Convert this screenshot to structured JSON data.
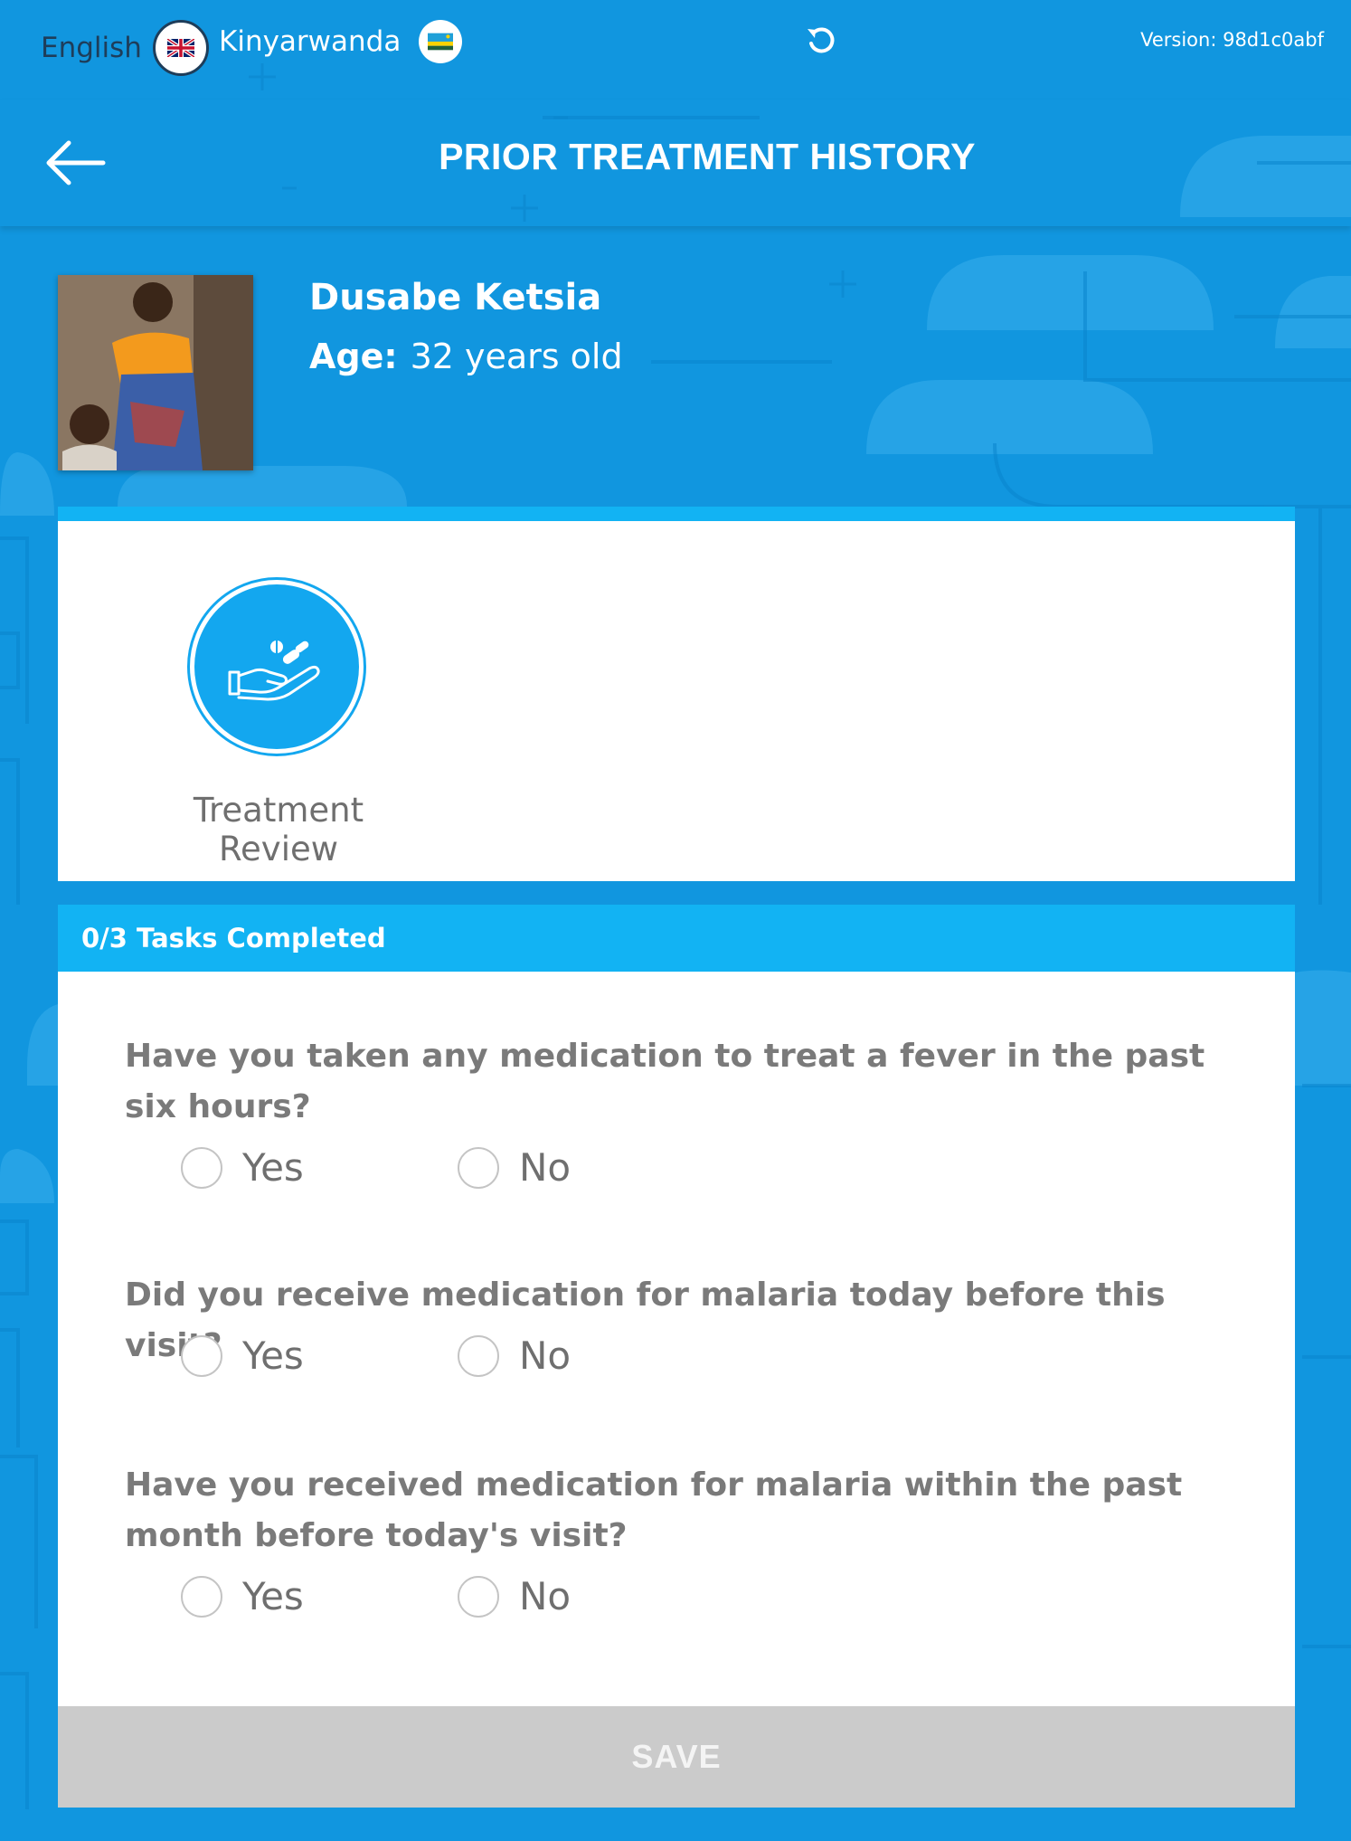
{
  "languages": [
    {
      "label": "English",
      "flag": "uk-flag-icon"
    },
    {
      "label": "Kinyarwanda",
      "flag": "rwanda-flag-icon"
    }
  ],
  "version": "Version: 98d1c0abf",
  "header": {
    "title": "PRIOR TREATMENT HISTORY"
  },
  "patient": {
    "name": "Dusabe Ketsia",
    "age_label": "Age:",
    "age_value": "32 years old"
  },
  "task": {
    "label": "Treatment Review",
    "icon": "medicine-hand-icon"
  },
  "form": {
    "progress": "0/3 Tasks Completed",
    "questions": [
      {
        "text": "Have you taken any medication to treat a fever in the past six hours?",
        "options": [
          "Yes",
          "No"
        ]
      },
      {
        "text": "Did you receive medication for malaria today before this visit?",
        "options": [
          "Yes",
          "No"
        ]
      },
      {
        "text": "Have you received medication for malaria within the past month before today's visit?",
        "options": [
          "Yes",
          "No"
        ]
      }
    ],
    "save_label": "SAVE"
  },
  "colors": {
    "background": "#1196df",
    "accent": "#12b3f3",
    "save_disabled": "#cbcbcb"
  }
}
